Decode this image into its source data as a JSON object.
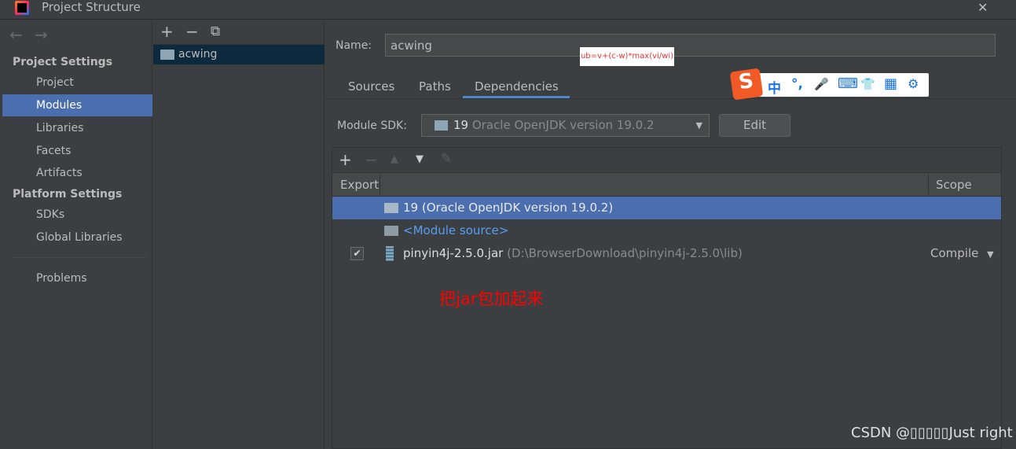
{
  "window": {
    "title": "Project Structure",
    "close": "✕"
  },
  "sidebar": {
    "back": "←",
    "forward": "→",
    "project_settings": "Project Settings",
    "items": [
      "Project",
      "Modules",
      "Libraries",
      "Facets",
      "Artifacts"
    ],
    "platform_settings": "Platform Settings",
    "platform_items": [
      "SDKs",
      "Global Libraries"
    ],
    "problems": "Problems",
    "selected": "Modules"
  },
  "modules": {
    "add": "+",
    "remove": "−",
    "copy": "⧉",
    "items": [
      "acwing"
    ]
  },
  "main": {
    "name_label": "Name:",
    "name_value": "acwing",
    "tabs": [
      "Sources",
      "Paths",
      "Dependencies"
    ],
    "active_tab": "Dependencies",
    "sdk_label": "Module SDK:",
    "sdk_number": "19",
    "sdk_value": "Oracle OpenJDK version 19.0.2",
    "edit": "Edit"
  },
  "table": {
    "toolbar": [
      "+",
      "−",
      "▲",
      "▼",
      "✎"
    ],
    "headers": {
      "export": "Export",
      "scope": "Scope"
    },
    "rows": [
      {
        "name": "19 (Oracle OpenJDK version 19.0.2)",
        "selected": true
      },
      {
        "name": "<Module source>"
      },
      {
        "name": "pinyin4j-2.5.0.jar",
        "path": "(D:\\BrowserDownload\\pinyin4j-2.5.0\\lib)",
        "checked": true,
        "scope": "Compile"
      }
    ]
  },
  "annotation": "把jar包加起来",
  "tooltip": "ub=v+(c-w)*max(vi/wi)",
  "ime": {
    "logo": "S",
    "items": [
      "中",
      "°,",
      "🎤",
      "⌨",
      "👕",
      "▦",
      "⚙"
    ]
  },
  "watermark": "CSDN @▯▯▯▯▯Just right",
  "colors": {
    "selection": "#4b6eaf",
    "module_selected": "#0d293e",
    "link": "#589df6",
    "annotation": "#ff0000"
  }
}
